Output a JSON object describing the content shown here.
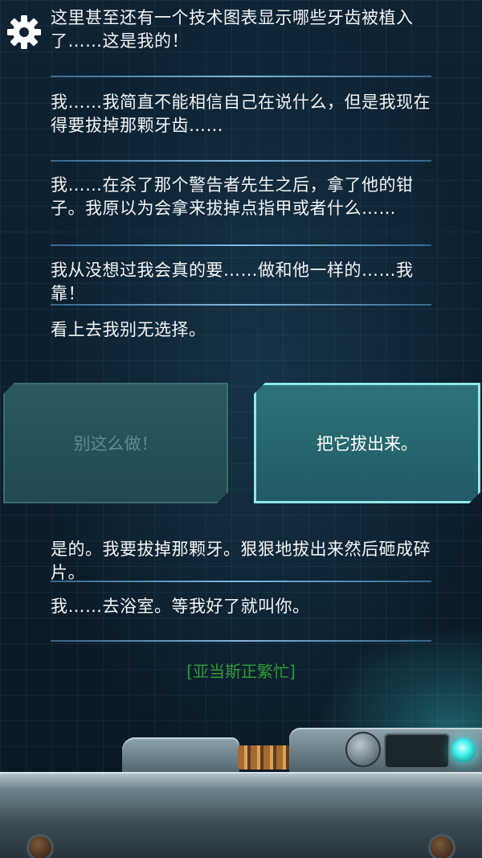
{
  "dialog": {
    "lines": [
      "这里甚至还有一个技术图表显示哪些牙齿被植入了……这是我的！",
      "我……我简直不能相信自己在说什么，但是我现在得要拔掉那颗牙齿……",
      "我……在杀了那个警告者先生之后，拿了他的钳子。我原以为会拿来拔掉点指甲或者什么……",
      "我从没想过我会真的要……做和他一样的……我靠！",
      "看上去我别无选择。"
    ],
    "after_choice": [
      "是的。我要拔掉那颗牙。狠狠地拔出来然后砸成碎片。",
      "我……去浴室。等我好了就叫你。"
    ],
    "status": "[亚当斯正繁忙]"
  },
  "choices": {
    "left": "别这么做！",
    "right": "把它拔出来。"
  },
  "icons": {
    "settings": "gear-icon",
    "console_knob": "dial-icon",
    "console_light": "indicator-light-icon"
  },
  "colors": {
    "text": "#f2f5f7",
    "status_green": "#2f9a37",
    "accent_cyan": "#8fe9e6"
  }
}
